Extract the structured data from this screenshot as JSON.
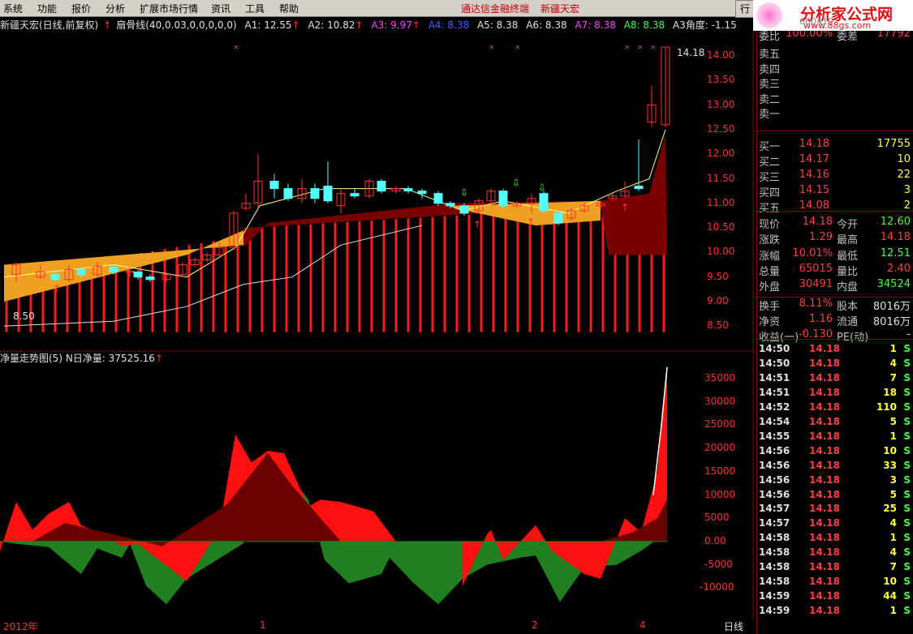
{
  "menu": {
    "items": [
      "系统",
      "功能",
      "报价",
      "分析",
      "扩展市场行情",
      "资讯",
      "工具",
      "帮助"
    ],
    "brand_left": "通达信金融终端",
    "brand_right": "新疆天宏",
    "hang_button": "行",
    "logo_title": "分析家公式网",
    "logo_url": "www.88gs.com"
  },
  "indicator_header": {
    "stock_label": "新疆天宏(日线,前复权)",
    "formula": "扇骨线(40,0.03,0,0,0,0,0)",
    "a1": "A1: 12.55",
    "a2": "A2: 10.82",
    "a3": "A3: 9.97",
    "a4": "A4: 8.38",
    "a5": "A5: 8.38",
    "a6": "A6: 8.38",
    "a7": "A7: 8.38",
    "a8": "A8: 8.38",
    "angle": "A3角度: -1.15"
  },
  "lower_header": {
    "name": "净量走势图(5)",
    "value": "N日净量: 37525.16"
  },
  "price_axis": {
    "labels": [
      "14.00",
      "13.50",
      "13.00",
      "12.50",
      "12.00",
      "11.50",
      "11.00",
      "10.50",
      "10.00",
      "9.50",
      "9.00",
      "8.50"
    ],
    "high_marker": "14.18",
    "low_marker": "8.50"
  },
  "volume_axis": {
    "labels": [
      "35000",
      "30000",
      "25000",
      "20000",
      "15000",
      "10000",
      "5000",
      "0.00",
      "-5000",
      "-10000"
    ]
  },
  "x_axis": {
    "labels": [
      "2012年",
      "1",
      "2",
      "4"
    ],
    "period": "日线"
  },
  "quote_panel": {
    "stock_code": "600419",
    "wei_bi_label": "委比",
    "wei_bi": "100.00%",
    "wei_cha_label": "委差",
    "wei_cha": "17792",
    "asks": [
      "卖五",
      "卖四",
      "卖三",
      "卖二",
      "卖一"
    ],
    "bids": [
      {
        "label": "买一",
        "price": "14.18",
        "vol": "17755"
      },
      {
        "label": "买二",
        "price": "14.17",
        "vol": "10"
      },
      {
        "label": "买三",
        "price": "14.16",
        "vol": "22"
      },
      {
        "label": "买四",
        "price": "14.15",
        "vol": "3"
      },
      {
        "label": "买五",
        "price": "14.08",
        "vol": "2"
      }
    ],
    "stats": [
      {
        "l": "现价",
        "v": "14.18",
        "l2": "今开",
        "v2": "12.60",
        "c2": "#40ff40"
      },
      {
        "l": "涨跌",
        "v": "1.29",
        "l2": "最高",
        "v2": "14.18",
        "c2": "#ff4040"
      },
      {
        "l": "涨幅",
        "v": "10.01%",
        "l2": "最低",
        "v2": "12.51",
        "c2": "#40ff40"
      },
      {
        "l": "总量",
        "v": "65015",
        "l2": "量比",
        "v2": "2.40",
        "c2": "#ff4040"
      },
      {
        "l": "外盘",
        "v": "30491",
        "l2": "内盘",
        "v2": "34524",
        "c2": "#40ff40"
      },
      {
        "l": "换手",
        "v": "8.11%",
        "l2": "股本",
        "v2": "8016万",
        "c2": "#e0e0e0"
      },
      {
        "l": "净资",
        "v": "1.16",
        "l2": "流通",
        "v2": "8016万",
        "c2": "#e0e0e0"
      },
      {
        "l": "收益(一)",
        "v": "-0.130",
        "l2": "PE(动)",
        "v2": "-",
        "c2": "#e0e0e0"
      }
    ],
    "trades": [
      {
        "t": "14:50",
        "p": "14.18",
        "v": "1",
        "d": "S"
      },
      {
        "t": "14:50",
        "p": "14.18",
        "v": "4",
        "d": "S"
      },
      {
        "t": "14:51",
        "p": "14.18",
        "v": "7",
        "d": "S"
      },
      {
        "t": "14:51",
        "p": "14.18",
        "v": "18",
        "d": "S"
      },
      {
        "t": "14:52",
        "p": "14.18",
        "v": "110",
        "d": "S"
      },
      {
        "t": "14:54",
        "p": "14.18",
        "v": "5",
        "d": "S"
      },
      {
        "t": "14:55",
        "p": "14.18",
        "v": "1",
        "d": "S"
      },
      {
        "t": "14:56",
        "p": "14.18",
        "v": "10",
        "d": "S"
      },
      {
        "t": "14:56",
        "p": "14.18",
        "v": "33",
        "d": "S"
      },
      {
        "t": "14:56",
        "p": "14.18",
        "v": "3",
        "d": "S"
      },
      {
        "t": "14:56",
        "p": "14.18",
        "v": "5",
        "d": "S"
      },
      {
        "t": "14:57",
        "p": "14.18",
        "v": "25",
        "d": "S"
      },
      {
        "t": "14:57",
        "p": "14.18",
        "v": "4",
        "d": "S"
      },
      {
        "t": "14:58",
        "p": "14.18",
        "v": "1",
        "d": "S"
      },
      {
        "t": "14:58",
        "p": "14.18",
        "v": "4",
        "d": "S"
      },
      {
        "t": "14:58",
        "p": "14.18",
        "v": "7",
        "d": "S"
      },
      {
        "t": "14:58",
        "p": "14.18",
        "v": "10",
        "d": "S"
      },
      {
        "t": "14:59",
        "p": "14.18",
        "v": "44",
        "d": "S"
      },
      {
        "t": "14:59",
        "p": "14.18",
        "v": "1",
        "d": "S"
      }
    ]
  },
  "colors": {
    "up": "#ff3030",
    "down": "#54ffff",
    "panel_border": "#800000"
  }
}
